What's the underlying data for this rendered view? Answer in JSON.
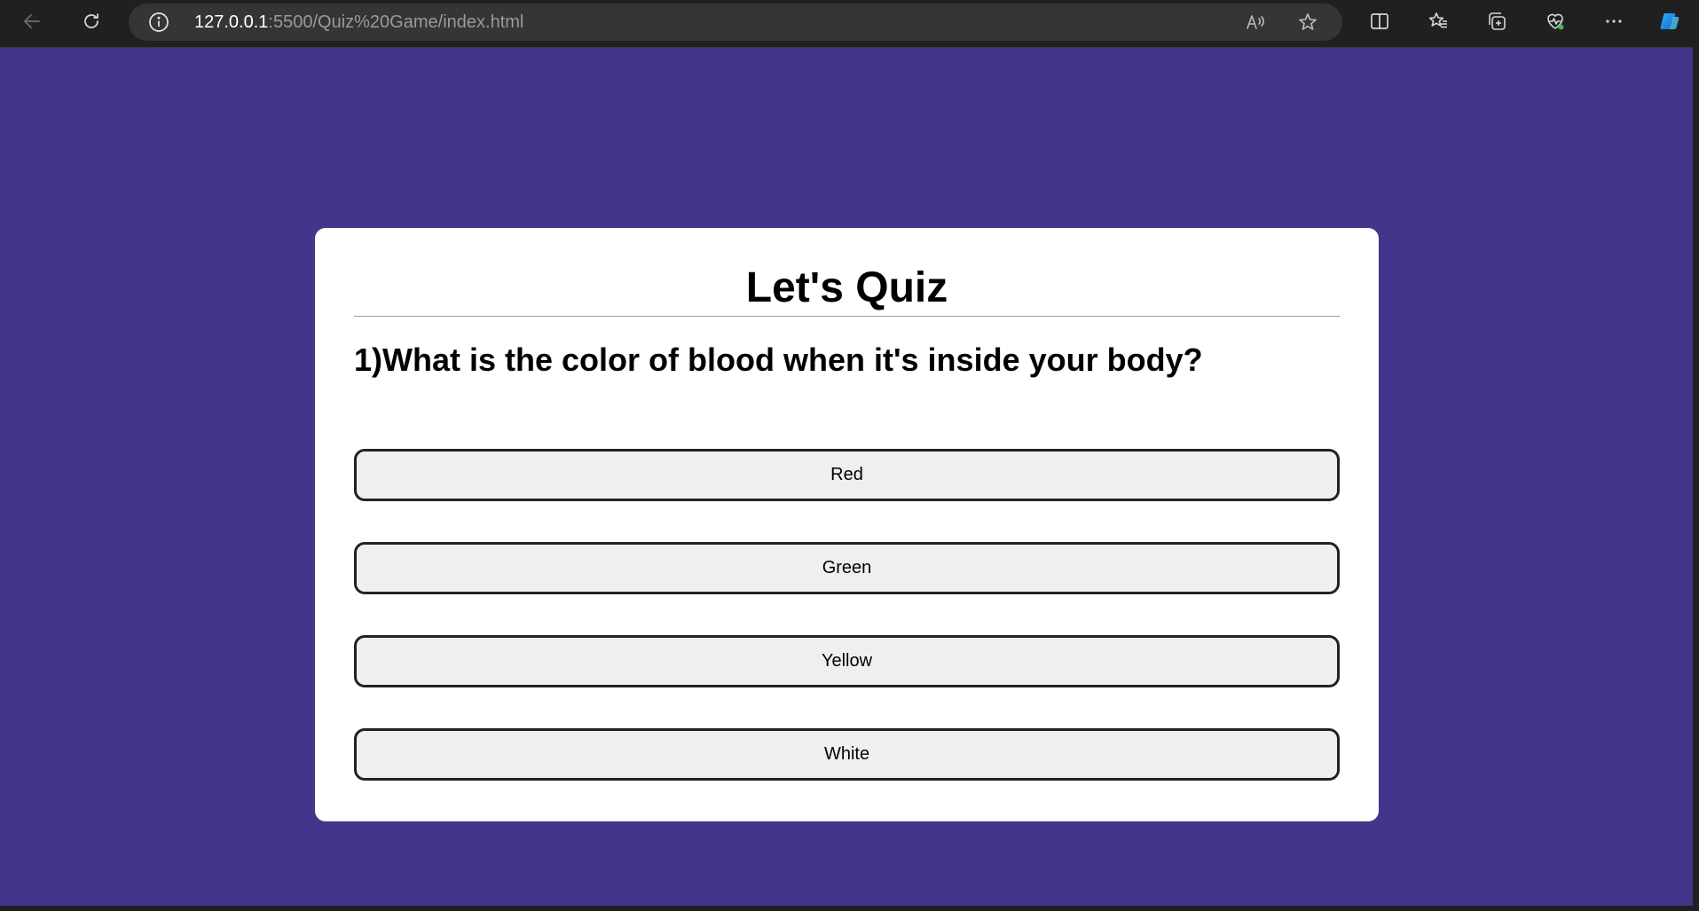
{
  "browser": {
    "url_host": "127.0.0.1",
    "url_rest": ":5500/Quiz%20Game/index.html",
    "icons": {
      "back": "back-arrow-icon",
      "refresh": "refresh-icon",
      "info": "info-icon",
      "read_aloud": "read-aloud-icon",
      "favorite": "star-icon",
      "split_screen": "split-screen-icon",
      "favorites": "favorites-icon",
      "collections": "collections-icon",
      "browser_essentials": "heart-pulse-icon",
      "more": "more-icon",
      "copilot": "copilot-icon"
    }
  },
  "page": {
    "background_color": "#44358c",
    "card_color": "#ffffff"
  },
  "quiz": {
    "title": "Let's Quiz",
    "question": "1)What is the color of blood when it's inside your body?",
    "answers": [
      {
        "label": "Red"
      },
      {
        "label": "Green"
      },
      {
        "label": "Yellow"
      },
      {
        "label": "White"
      }
    ]
  }
}
